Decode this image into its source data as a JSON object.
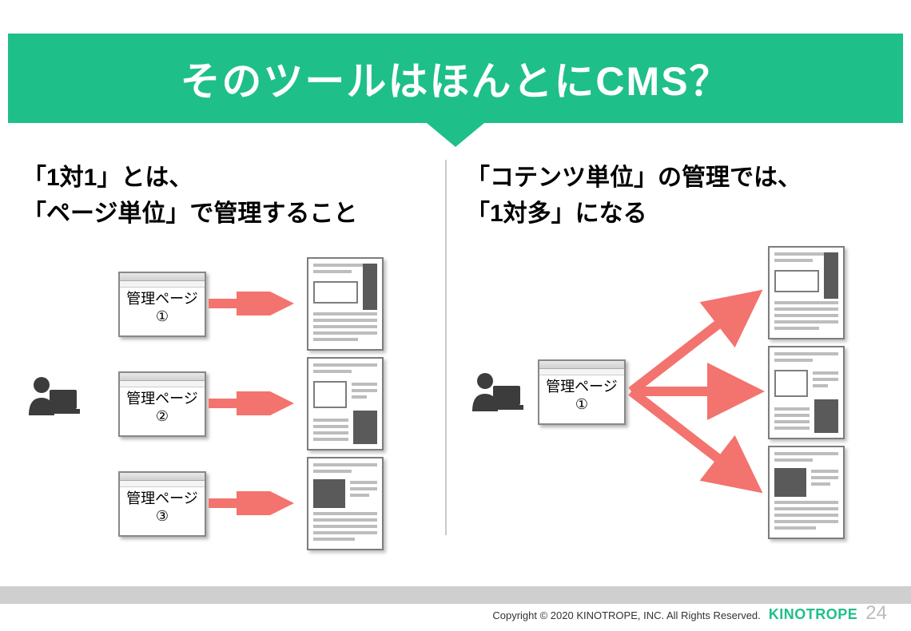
{
  "title": "そのツールはほんとにCMS？",
  "left": {
    "heading_line1": "「1対1」とは、",
    "heading_line2": "「ページ単位」で管理すること",
    "admin1": "管理ページ\n①",
    "admin2": "管理ページ\n②",
    "admin3": "管理ページ\n③"
  },
  "right": {
    "heading_line1": "「コテンツ単位」の管理では、",
    "heading_line2": "「1対多」になる",
    "admin1": "管理ページ\n①"
  },
  "footer": {
    "copyright": "Copyright © 2020 KINOTROPE, INC. All Rights Reserved.",
    "brand": "KINOTROPE",
    "page": "24"
  }
}
